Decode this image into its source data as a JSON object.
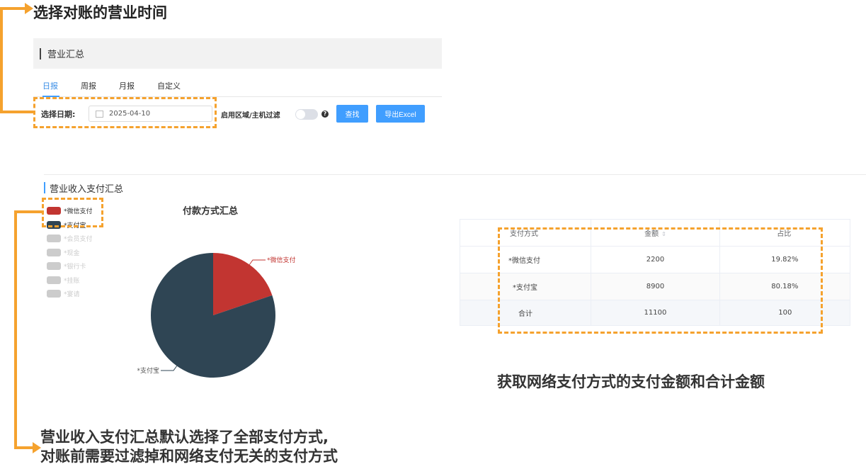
{
  "annotations": {
    "top": "选择对账的营业时间",
    "right": "获取网络支付方式的支付金额和合计金额",
    "bottom_line1": "营业收入支付汇总默认选择了全部支付方式,",
    "bottom_line2": "对账前需要过滤掉和网络支付无关的支付方式",
    "accent_color": "#f5a22e"
  },
  "header": {
    "title": "营业汇总"
  },
  "tabs": [
    {
      "label": "日报",
      "active": true
    },
    {
      "label": "周报",
      "active": false
    },
    {
      "label": "月报",
      "active": false
    },
    {
      "label": "自定义",
      "active": false
    }
  ],
  "filters": {
    "date_label": "选择日期:",
    "date_value": "2025-04-10",
    "filter_label": "启用区域/主机过滤",
    "filter_enabled": false,
    "help_icon": "question-icon",
    "search_button": "查找",
    "export_button": "导出Excel"
  },
  "section": {
    "title": "营业收入支付汇总"
  },
  "legend": [
    {
      "label": "*微信支付",
      "color": "#c23531",
      "selected": true
    },
    {
      "label": "*支付宝",
      "color": "#2f4554",
      "selected": true
    },
    {
      "label": "*会员支付",
      "color": "#cccccc",
      "selected": false
    },
    {
      "label": "*现金",
      "color": "#cccccc",
      "selected": false
    },
    {
      "label": "*银行卡",
      "color": "#cccccc",
      "selected": false
    },
    {
      "label": "*挂账",
      "color": "#cccccc",
      "selected": false
    },
    {
      "label": "*宴请",
      "color": "#cccccc",
      "selected": false
    }
  ],
  "chart_data": {
    "type": "pie",
    "title": "付款方式汇总",
    "slices": [
      {
        "name": "*微信支付",
        "value": 2200,
        "color": "#c23531"
      },
      {
        "name": "*支付宝",
        "value": 8900,
        "color": "#2f4554"
      }
    ]
  },
  "table": {
    "headers": [
      "支付方式",
      "金额",
      "占比"
    ],
    "sortable_column": "金额",
    "rows": [
      [
        "*微信支付",
        "2200",
        "19.82%"
      ],
      [
        "*支付宝",
        "8900",
        "80.18%"
      ]
    ],
    "total": [
      "合计",
      "11100",
      "100"
    ]
  }
}
